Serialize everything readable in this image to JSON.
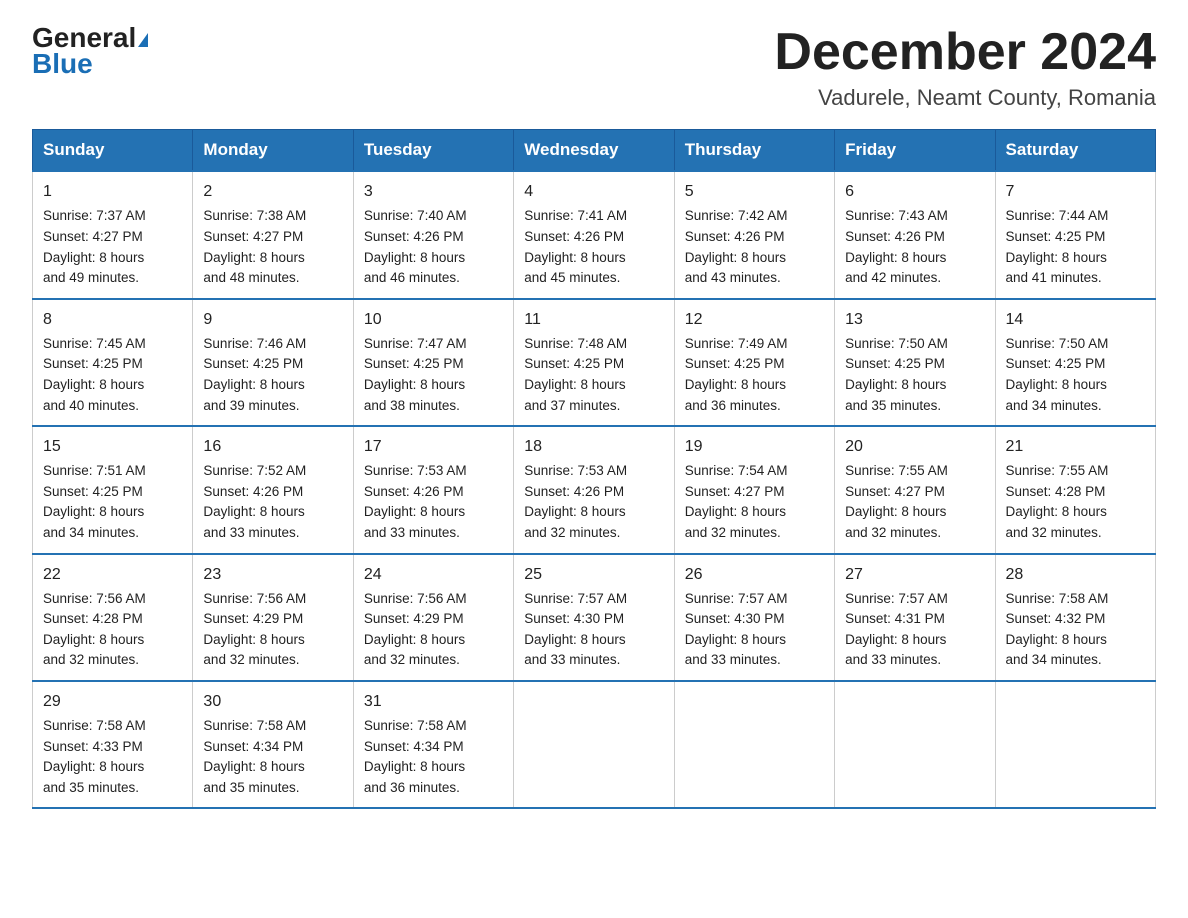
{
  "header": {
    "logo_line1": "General",
    "logo_line2": "Blue",
    "month_year": "December 2024",
    "location": "Vadurele, Neamt County, Romania"
  },
  "days_of_week": [
    "Sunday",
    "Monday",
    "Tuesday",
    "Wednesday",
    "Thursday",
    "Friday",
    "Saturday"
  ],
  "weeks": [
    [
      {
        "day": "1",
        "sunrise": "7:37 AM",
        "sunset": "4:27 PM",
        "daylight": "8 hours and 49 minutes."
      },
      {
        "day": "2",
        "sunrise": "7:38 AM",
        "sunset": "4:27 PM",
        "daylight": "8 hours and 48 minutes."
      },
      {
        "day": "3",
        "sunrise": "7:40 AM",
        "sunset": "4:26 PM",
        "daylight": "8 hours and 46 minutes."
      },
      {
        "day": "4",
        "sunrise": "7:41 AM",
        "sunset": "4:26 PM",
        "daylight": "8 hours and 45 minutes."
      },
      {
        "day": "5",
        "sunrise": "7:42 AM",
        "sunset": "4:26 PM",
        "daylight": "8 hours and 43 minutes."
      },
      {
        "day": "6",
        "sunrise": "7:43 AM",
        "sunset": "4:26 PM",
        "daylight": "8 hours and 42 minutes."
      },
      {
        "day": "7",
        "sunrise": "7:44 AM",
        "sunset": "4:25 PM",
        "daylight": "8 hours and 41 minutes."
      }
    ],
    [
      {
        "day": "8",
        "sunrise": "7:45 AM",
        "sunset": "4:25 PM",
        "daylight": "8 hours and 40 minutes."
      },
      {
        "day": "9",
        "sunrise": "7:46 AM",
        "sunset": "4:25 PM",
        "daylight": "8 hours and 39 minutes."
      },
      {
        "day": "10",
        "sunrise": "7:47 AM",
        "sunset": "4:25 PM",
        "daylight": "8 hours and 38 minutes."
      },
      {
        "day": "11",
        "sunrise": "7:48 AM",
        "sunset": "4:25 PM",
        "daylight": "8 hours and 37 minutes."
      },
      {
        "day": "12",
        "sunrise": "7:49 AM",
        "sunset": "4:25 PM",
        "daylight": "8 hours and 36 minutes."
      },
      {
        "day": "13",
        "sunrise": "7:50 AM",
        "sunset": "4:25 PM",
        "daylight": "8 hours and 35 minutes."
      },
      {
        "day": "14",
        "sunrise": "7:50 AM",
        "sunset": "4:25 PM",
        "daylight": "8 hours and 34 minutes."
      }
    ],
    [
      {
        "day": "15",
        "sunrise": "7:51 AM",
        "sunset": "4:25 PM",
        "daylight": "8 hours and 34 minutes."
      },
      {
        "day": "16",
        "sunrise": "7:52 AM",
        "sunset": "4:26 PM",
        "daylight": "8 hours and 33 minutes."
      },
      {
        "day": "17",
        "sunrise": "7:53 AM",
        "sunset": "4:26 PM",
        "daylight": "8 hours and 33 minutes."
      },
      {
        "day": "18",
        "sunrise": "7:53 AM",
        "sunset": "4:26 PM",
        "daylight": "8 hours and 32 minutes."
      },
      {
        "day": "19",
        "sunrise": "7:54 AM",
        "sunset": "4:27 PM",
        "daylight": "8 hours and 32 minutes."
      },
      {
        "day": "20",
        "sunrise": "7:55 AM",
        "sunset": "4:27 PM",
        "daylight": "8 hours and 32 minutes."
      },
      {
        "day": "21",
        "sunrise": "7:55 AM",
        "sunset": "4:28 PM",
        "daylight": "8 hours and 32 minutes."
      }
    ],
    [
      {
        "day": "22",
        "sunrise": "7:56 AM",
        "sunset": "4:28 PM",
        "daylight": "8 hours and 32 minutes."
      },
      {
        "day": "23",
        "sunrise": "7:56 AM",
        "sunset": "4:29 PM",
        "daylight": "8 hours and 32 minutes."
      },
      {
        "day": "24",
        "sunrise": "7:56 AM",
        "sunset": "4:29 PM",
        "daylight": "8 hours and 32 minutes."
      },
      {
        "day": "25",
        "sunrise": "7:57 AM",
        "sunset": "4:30 PM",
        "daylight": "8 hours and 33 minutes."
      },
      {
        "day": "26",
        "sunrise": "7:57 AM",
        "sunset": "4:30 PM",
        "daylight": "8 hours and 33 minutes."
      },
      {
        "day": "27",
        "sunrise": "7:57 AM",
        "sunset": "4:31 PM",
        "daylight": "8 hours and 33 minutes."
      },
      {
        "day": "28",
        "sunrise": "7:58 AM",
        "sunset": "4:32 PM",
        "daylight": "8 hours and 34 minutes."
      }
    ],
    [
      {
        "day": "29",
        "sunrise": "7:58 AM",
        "sunset": "4:33 PM",
        "daylight": "8 hours and 35 minutes."
      },
      {
        "day": "30",
        "sunrise": "7:58 AM",
        "sunset": "4:34 PM",
        "daylight": "8 hours and 35 minutes."
      },
      {
        "day": "31",
        "sunrise": "7:58 AM",
        "sunset": "4:34 PM",
        "daylight": "8 hours and 36 minutes."
      },
      null,
      null,
      null,
      null
    ]
  ],
  "labels": {
    "sunrise": "Sunrise:",
    "sunset": "Sunset:",
    "daylight": "Daylight:"
  }
}
